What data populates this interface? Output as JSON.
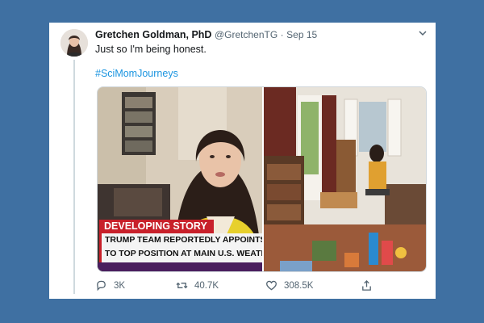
{
  "tweet": {
    "author_name": "Gretchen Goldman, PhD",
    "handle": "@GretchenTG",
    "separator": "·",
    "date": "Sep 15",
    "text": "Just so I'm being honest.",
    "hashtag": "#SciMomJourneys"
  },
  "media": {
    "chyron_banner": "DEVELOPING STORY",
    "chyron_line1": "TRUMP TEAM REPORTEDLY APPOINTS C",
    "chyron_line2": "TO TOP POSITION AT MAIN U.S. WEATH"
  },
  "actions": {
    "reply_count": "3K",
    "retweet_count": "40.7K",
    "like_count": "308.5K"
  },
  "colors": {
    "background": "#3f70a2",
    "hashtag": "#1b95e0",
    "chyron_red": "#c8202a"
  },
  "icons": [
    "avatar",
    "chevron-down-icon",
    "reply-icon",
    "retweet-icon",
    "like-icon",
    "share-icon"
  ]
}
